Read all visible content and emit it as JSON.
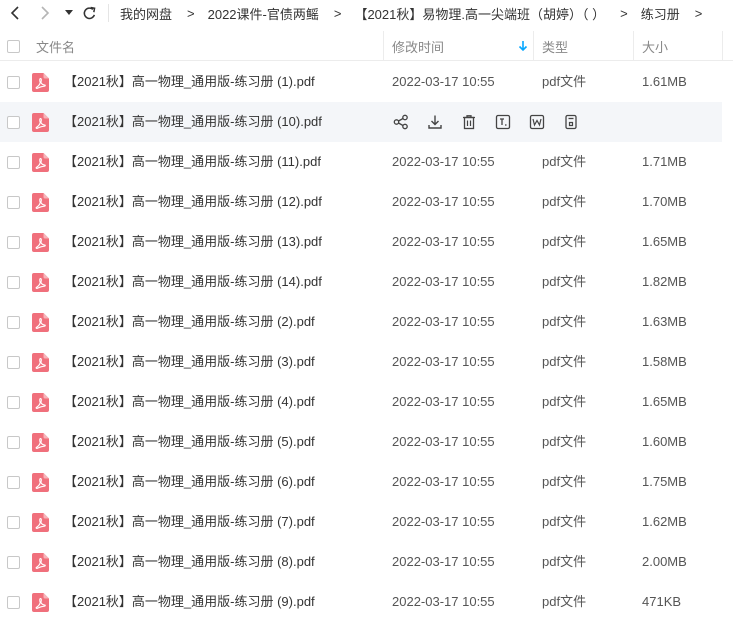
{
  "breadcrumb": [
    {
      "label": "我的网盘"
    },
    {
      "label": "2022课件-官债两鳐"
    },
    {
      "label": "【2021秋】易物理.高一尖端班（胡婷）（ ）"
    },
    {
      "label": "练习册"
    }
  ],
  "header": {
    "name": "文件名",
    "modified": "修改时间",
    "type": "类型",
    "size": "大小"
  },
  "colors": {
    "pdf_icon": "#f0707c",
    "sort_arrow": "#06a7ff",
    "row_hover": "#f4f6f9",
    "action_icon": "#444444"
  },
  "hover_actions": [
    "share-icon",
    "download-icon",
    "delete-icon",
    "rename-icon",
    "word-convert-icon",
    "more-icon"
  ],
  "files": [
    {
      "name": "【2021秋】高一物理_通用版-练习册 (1).pdf",
      "date": "2022-03-17 10:55",
      "type": "pdf文件",
      "size": "1.61MB"
    },
    {
      "name": "【2021秋】高一物理_通用版-练习册 (10).pdf",
      "date": "",
      "type": "",
      "size": "",
      "hover": true
    },
    {
      "name": "【2021秋】高一物理_通用版-练习册 (11).pdf",
      "date": "2022-03-17 10:55",
      "type": "pdf文件",
      "size": "1.71MB"
    },
    {
      "name": "【2021秋】高一物理_通用版-练习册 (12).pdf",
      "date": "2022-03-17 10:55",
      "type": "pdf文件",
      "size": "1.70MB"
    },
    {
      "name": "【2021秋】高一物理_通用版-练习册 (13).pdf",
      "date": "2022-03-17 10:55",
      "type": "pdf文件",
      "size": "1.65MB"
    },
    {
      "name": "【2021秋】高一物理_通用版-练习册 (14).pdf",
      "date": "2022-03-17 10:55",
      "type": "pdf文件",
      "size": "1.82MB"
    },
    {
      "name": "【2021秋】高一物理_通用版-练习册 (2).pdf",
      "date": "2022-03-17 10:55",
      "type": "pdf文件",
      "size": "1.63MB"
    },
    {
      "name": "【2021秋】高一物理_通用版-练习册 (3).pdf",
      "date": "2022-03-17 10:55",
      "type": "pdf文件",
      "size": "1.58MB"
    },
    {
      "name": "【2021秋】高一物理_通用版-练习册 (4).pdf",
      "date": "2022-03-17 10:55",
      "type": "pdf文件",
      "size": "1.65MB"
    },
    {
      "name": "【2021秋】高一物理_通用版-练习册 (5).pdf",
      "date": "2022-03-17 10:55",
      "type": "pdf文件",
      "size": "1.60MB"
    },
    {
      "name": "【2021秋】高一物理_通用版-练习册 (6).pdf",
      "date": "2022-03-17 10:55",
      "type": "pdf文件",
      "size": "1.75MB"
    },
    {
      "name": "【2021秋】高一物理_通用版-练习册 (7).pdf",
      "date": "2022-03-17 10:55",
      "type": "pdf文件",
      "size": "1.62MB"
    },
    {
      "name": "【2021秋】高一物理_通用版-练习册 (8).pdf",
      "date": "2022-03-17 10:55",
      "type": "pdf文件",
      "size": "2.00MB"
    },
    {
      "name": "【2021秋】高一物理_通用版-练习册 (9).pdf",
      "date": "2022-03-17 10:55",
      "type": "pdf文件",
      "size": "471KB"
    }
  ]
}
